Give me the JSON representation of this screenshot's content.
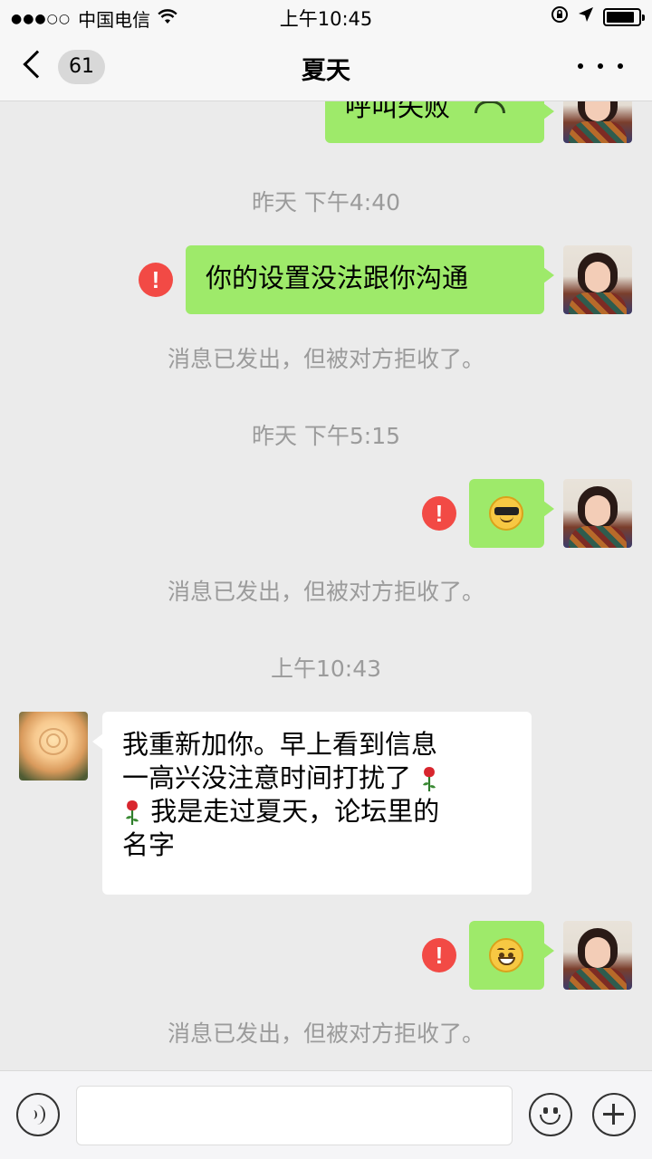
{
  "status_bar": {
    "signal": "●●●○○",
    "carrier": "中国电信",
    "time": "上午10:45"
  },
  "nav": {
    "unread_count": "61",
    "title": "夏天"
  },
  "messages": {
    "m0_text": "呼叫失败",
    "t1": "昨天 下午4:40",
    "m1_text": "你的设置没法跟你沟通",
    "note1": "消息已发出，但被对方拒收了。",
    "t2": "昨天 下午5:15",
    "note2": "消息已发出，但被对方拒收了。",
    "t3": "上午10:43",
    "m3_line1": "我重新加你。早上看到信息",
    "m3_line2": "一高兴没注意时间打扰了",
    "m3_line3": "我是走过夏天，论坛里的",
    "m3_line4": "名字",
    "note3": "消息已发出，但被对方拒收了。",
    "error_mark": "!"
  },
  "icons": {
    "back": "chevron-left-icon",
    "more": "more-dots-icon",
    "voice": "voice-icon",
    "emoji": "emoji-icon",
    "plus": "plus-icon",
    "error": "error-icon",
    "hangup": "hangup-icon",
    "rose": "rose-emoji"
  },
  "colors": {
    "out_bubble": "#9eea6a",
    "in_bubble": "#ffffff",
    "error": "#f24a45",
    "background": "#ebebeb"
  }
}
